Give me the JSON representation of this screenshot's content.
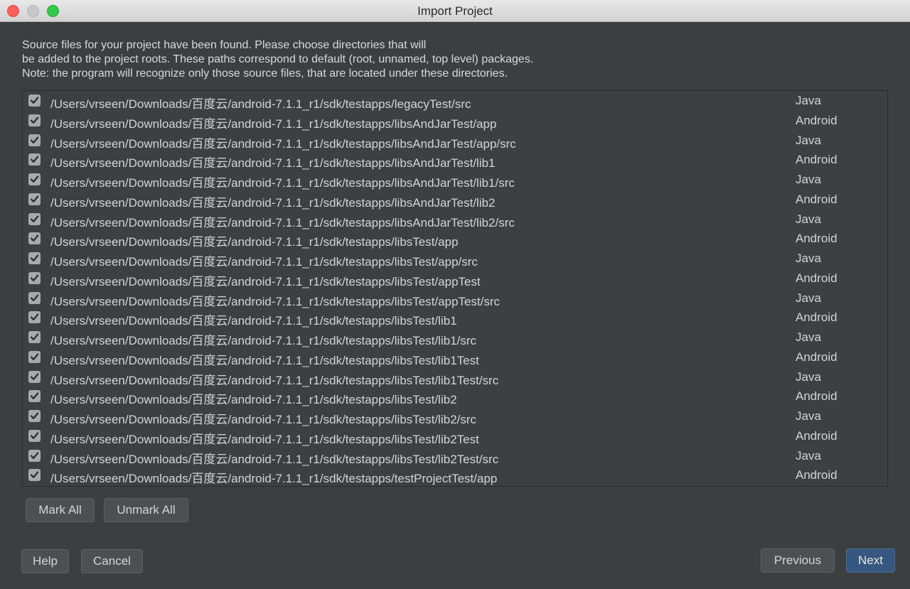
{
  "window": {
    "title": "Import Project"
  },
  "description": [
    "Source files for your project have been found. Please choose directories that will",
    "be added to the project roots. These paths correspond to default (root, unnamed, top level) packages.",
    "Note: the program will recognize only those source files, that are located under these directories."
  ],
  "roots": [
    {
      "path": "/Users/vrseen/Downloads/百度云/android-7.1.1_r1/sdk/testapps/legacyTest/src",
      "type": "Java",
      "checked": true
    },
    {
      "path": "/Users/vrseen/Downloads/百度云/android-7.1.1_r1/sdk/testapps/libsAndJarTest/app",
      "type": "Android",
      "checked": true
    },
    {
      "path": "/Users/vrseen/Downloads/百度云/android-7.1.1_r1/sdk/testapps/libsAndJarTest/app/src",
      "type": "Java",
      "checked": true
    },
    {
      "path": "/Users/vrseen/Downloads/百度云/android-7.1.1_r1/sdk/testapps/libsAndJarTest/lib1",
      "type": "Android",
      "checked": true
    },
    {
      "path": "/Users/vrseen/Downloads/百度云/android-7.1.1_r1/sdk/testapps/libsAndJarTest/lib1/src",
      "type": "Java",
      "checked": true
    },
    {
      "path": "/Users/vrseen/Downloads/百度云/android-7.1.1_r1/sdk/testapps/libsAndJarTest/lib2",
      "type": "Android",
      "checked": true
    },
    {
      "path": "/Users/vrseen/Downloads/百度云/android-7.1.1_r1/sdk/testapps/libsAndJarTest/lib2/src",
      "type": "Java",
      "checked": true
    },
    {
      "path": "/Users/vrseen/Downloads/百度云/android-7.1.1_r1/sdk/testapps/libsTest/app",
      "type": "Android",
      "checked": true
    },
    {
      "path": "/Users/vrseen/Downloads/百度云/android-7.1.1_r1/sdk/testapps/libsTest/app/src",
      "type": "Java",
      "checked": true
    },
    {
      "path": "/Users/vrseen/Downloads/百度云/android-7.1.1_r1/sdk/testapps/libsTest/appTest",
      "type": "Android",
      "checked": true
    },
    {
      "path": "/Users/vrseen/Downloads/百度云/android-7.1.1_r1/sdk/testapps/libsTest/appTest/src",
      "type": "Java",
      "checked": true
    },
    {
      "path": "/Users/vrseen/Downloads/百度云/android-7.1.1_r1/sdk/testapps/libsTest/lib1",
      "type": "Android",
      "checked": true
    },
    {
      "path": "/Users/vrseen/Downloads/百度云/android-7.1.1_r1/sdk/testapps/libsTest/lib1/src",
      "type": "Java",
      "checked": true
    },
    {
      "path": "/Users/vrseen/Downloads/百度云/android-7.1.1_r1/sdk/testapps/libsTest/lib1Test",
      "type": "Android",
      "checked": true
    },
    {
      "path": "/Users/vrseen/Downloads/百度云/android-7.1.1_r1/sdk/testapps/libsTest/lib1Test/src",
      "type": "Java",
      "checked": true
    },
    {
      "path": "/Users/vrseen/Downloads/百度云/android-7.1.1_r1/sdk/testapps/libsTest/lib2",
      "type": "Android",
      "checked": true
    },
    {
      "path": "/Users/vrseen/Downloads/百度云/android-7.1.1_r1/sdk/testapps/libsTest/lib2/src",
      "type": "Java",
      "checked": true
    },
    {
      "path": "/Users/vrseen/Downloads/百度云/android-7.1.1_r1/sdk/testapps/libsTest/lib2Test",
      "type": "Android",
      "checked": true
    },
    {
      "path": "/Users/vrseen/Downloads/百度云/android-7.1.1_r1/sdk/testapps/libsTest/lib2Test/src",
      "type": "Java",
      "checked": true
    },
    {
      "path": "/Users/vrseen/Downloads/百度云/android-7.1.1_r1/sdk/testapps/testProjectTest/app",
      "type": "Android",
      "checked": true
    }
  ],
  "buttons": {
    "mark_all": "Mark All",
    "unmark_all": "Unmark All",
    "help": "Help",
    "cancel": "Cancel",
    "previous": "Previous",
    "next": "Next"
  },
  "colors": {
    "background": "#3c3f41",
    "primary_button": "#365880",
    "checkbox": "#a7a9ab"
  }
}
